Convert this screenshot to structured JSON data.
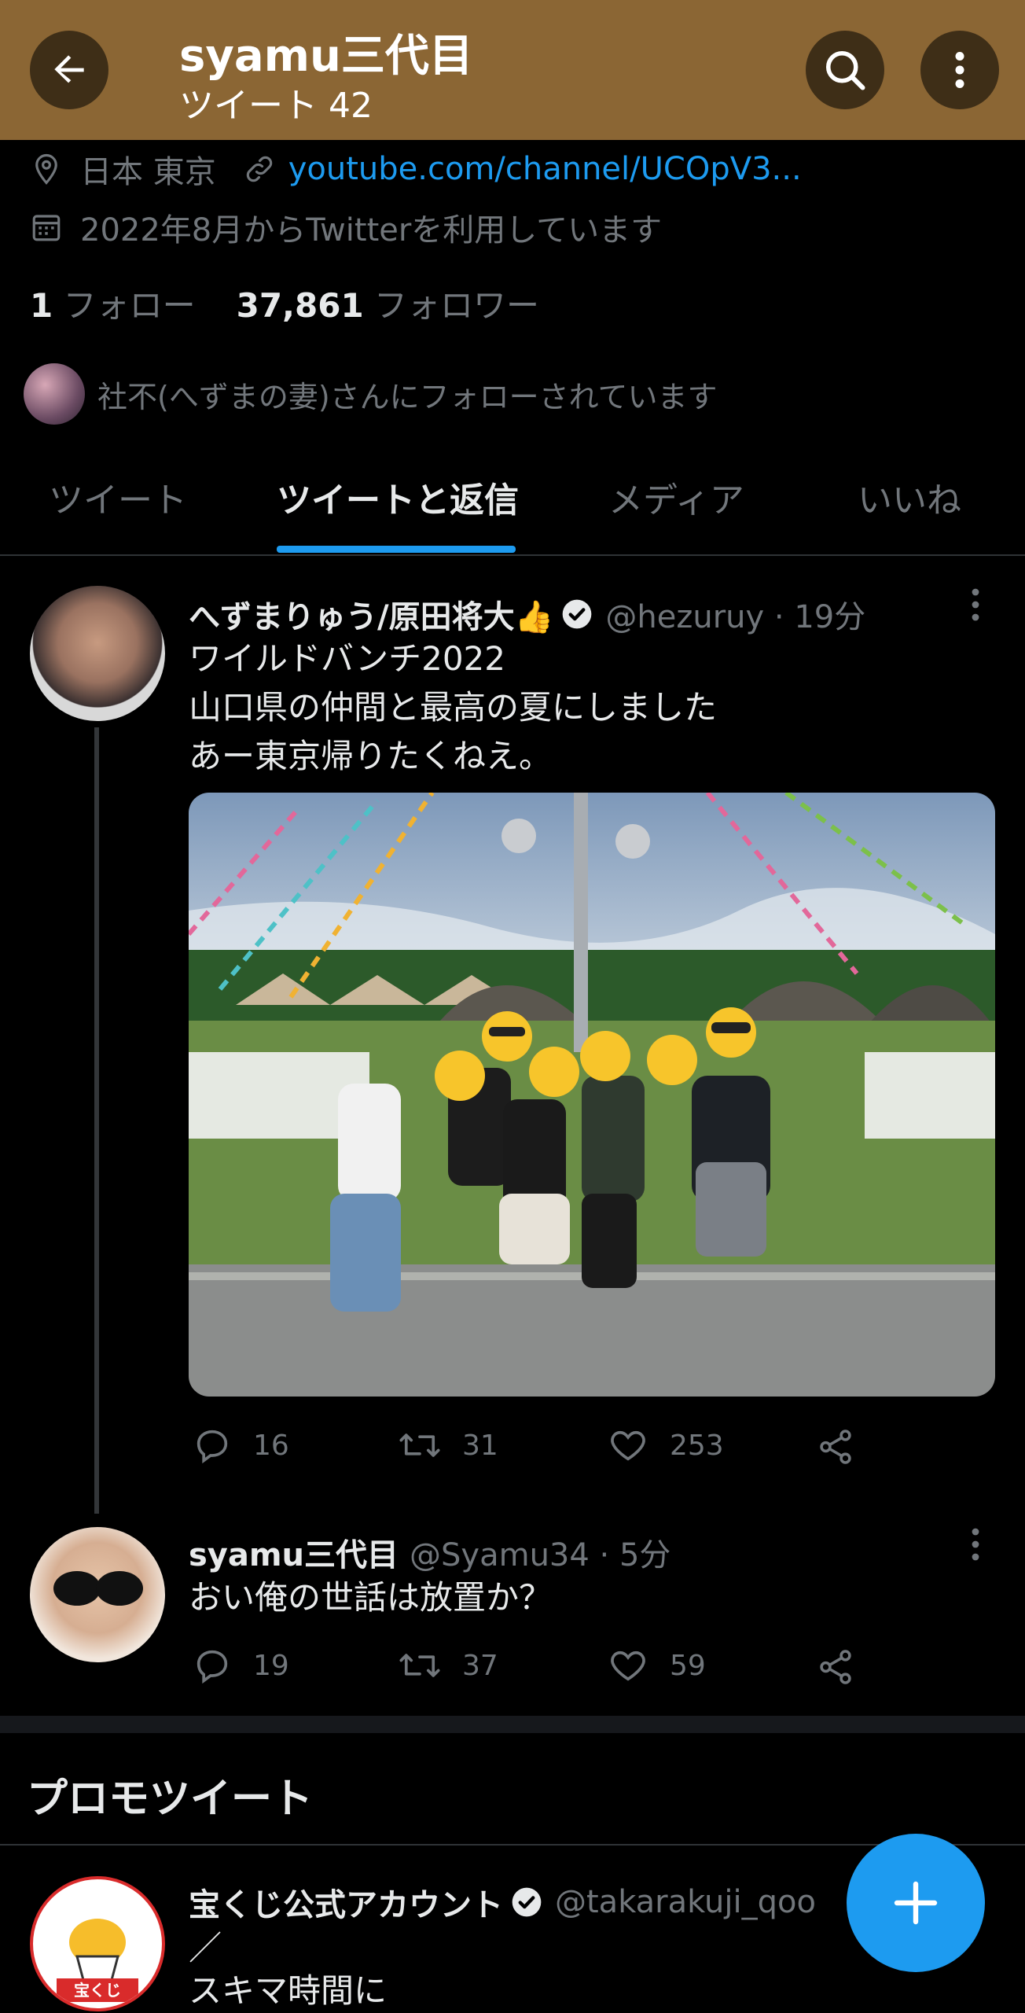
{
  "header": {
    "title": "syamu三代目",
    "subtitle": "ツイート 42"
  },
  "profile": {
    "location": "日本 東京",
    "website": "youtube.com/channel/UCOpV3...",
    "joined": "2022年8月からTwitterを利用しています",
    "following_count": "1",
    "following_label": "フォロー",
    "followers_count": "37,861",
    "followers_label": "フォロワー",
    "followed_by": "社不(へずまの妻)さんにフォローされています"
  },
  "tabs": [
    {
      "label": "ツイート",
      "active": false
    },
    {
      "label": "ツイートと返信",
      "active": true
    },
    {
      "label": "メディア",
      "active": false
    },
    {
      "label": "いいね",
      "active": false
    }
  ],
  "tweets": [
    {
      "name": "へずまりゅう/原田将大👍",
      "handle": "@hezuruy · 19分",
      "lines": [
        "ワイルドバンチ2022",
        "山口県の仲間と最高の夏にしました",
        "あー東京帰りたくねえ。"
      ],
      "replies": "16",
      "retweets": "31",
      "likes": "253"
    },
    {
      "name": "syamu三代目",
      "handle": "@Syamu34 · 5分",
      "lines": [
        "おい俺の世話は放置か？"
      ],
      "replies": "19",
      "retweets": "37",
      "likes": "59"
    }
  ],
  "promo": {
    "heading": "プロモツイート",
    "name": "宝くじ公式アカウント",
    "handle": "@takarakuji_qoo",
    "lines": [
      "／",
      "スキマ時間に"
    ],
    "logo_text": "宝くじ"
  },
  "colors": {
    "header_bg": "#8b6634",
    "accent": "#1d9bf0",
    "background": "#000000"
  }
}
